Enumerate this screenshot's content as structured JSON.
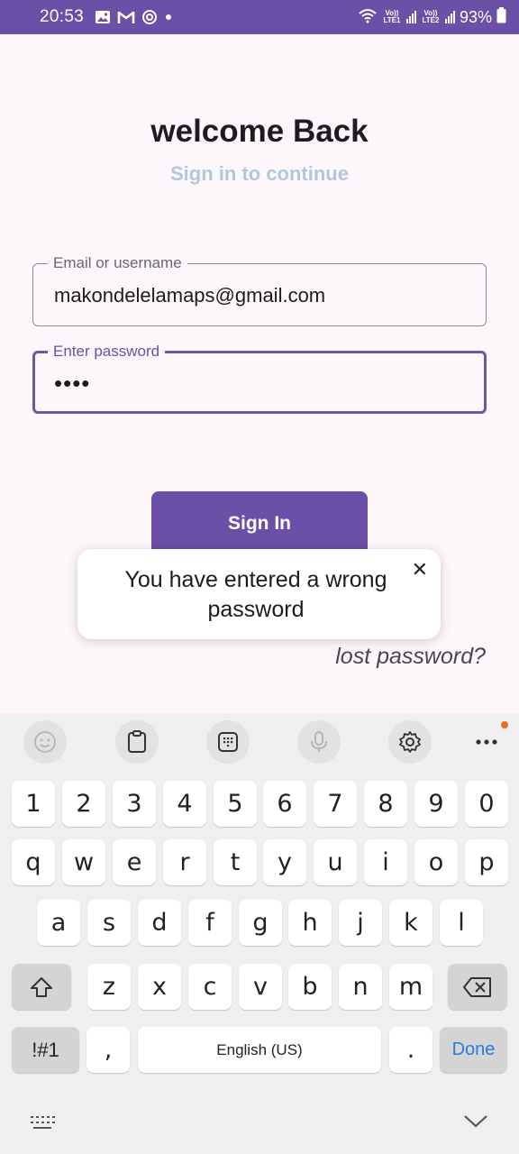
{
  "status": {
    "time": "20:53",
    "battery": "93%",
    "icons_left": [
      "gallery-icon",
      "gmail-icon",
      "sync-icon",
      "dot-icon"
    ],
    "icons_right": [
      "wifi-calling-icon",
      "volte-lte1-icon",
      "signal-1-icon",
      "volte-lte2-icon",
      "signal-2-icon",
      "battery-icon"
    ],
    "volte1": "Vo)) LTE1",
    "volte2": "Vo)) LTE2"
  },
  "login": {
    "title": "welcome Back",
    "subtitle": "Sign in to continue",
    "email": {
      "label": "Email or username",
      "value": "makondelelamaps@gmail.com"
    },
    "password": {
      "label": "Enter password",
      "value": "••••"
    },
    "signin_label": "Sign In",
    "lost_password": "lost password?"
  },
  "toast": {
    "message": "You have entered a wrong password",
    "close": "✕"
  },
  "keyboard": {
    "toolbar": [
      "emoji-icon",
      "clipboard-icon",
      "keypad-icon",
      "mic-icon",
      "settings-icon",
      "more-icon"
    ],
    "row_numbers": [
      "1",
      "2",
      "3",
      "4",
      "5",
      "6",
      "7",
      "8",
      "9",
      "0"
    ],
    "row_q": [
      "q",
      "w",
      "e",
      "r",
      "t",
      "y",
      "u",
      "i",
      "o",
      "p"
    ],
    "row_a": [
      "a",
      "s",
      "d",
      "f",
      "g",
      "h",
      "j",
      "k",
      "l"
    ],
    "row_z": [
      "z",
      "x",
      "c",
      "v",
      "b",
      "n",
      "m"
    ],
    "symbols": "!#1",
    "comma": ",",
    "space": "English (US)",
    "period": ".",
    "done": "Done"
  },
  "colors": {
    "primary": "#6a50a7",
    "subtitle": "#b2c6dc",
    "background": "#fdf7fc",
    "done": "#2a7be0"
  }
}
